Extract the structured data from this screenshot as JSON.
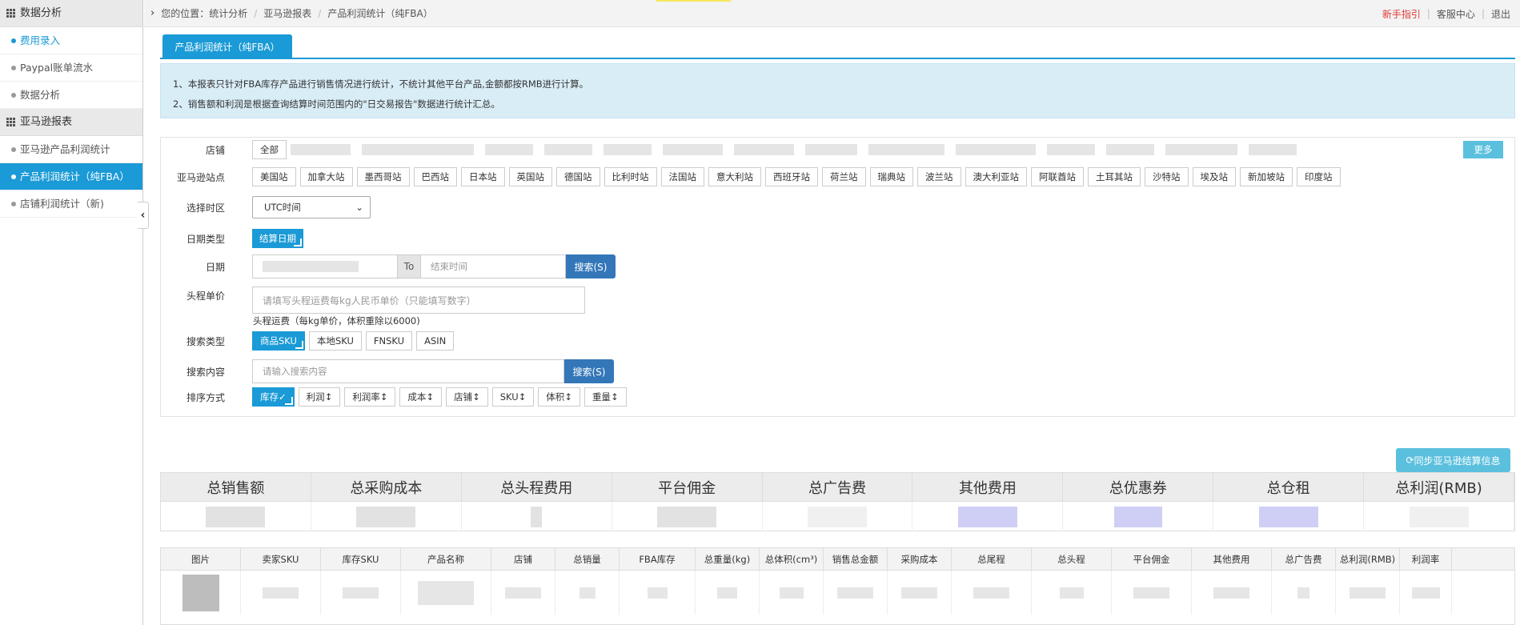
{
  "sidebar": {
    "groups": [
      {
        "title": "数据分析",
        "items": [
          "费用录入",
          "Paypal账单流水",
          "数据分析"
        ]
      },
      {
        "title": "亚马逊报表",
        "items": [
          "亚马逊产品利润统计",
          "产品利润统计（纯FBA）",
          "店铺利润统计（新)"
        ]
      }
    ],
    "active_item": "产品利润统计（纯FBA）",
    "collapse_icon": "chevron-left-icon"
  },
  "topbar": {
    "prefix": "您的位置：",
    "breadcrumb": [
      "统计分析",
      "亚马逊报表",
      "产品利润统计（纯FBA）"
    ],
    "links": [
      "新手指引",
      "客服中心",
      "退出"
    ]
  },
  "tab": {
    "label": "产品利润统计（纯FBA）"
  },
  "notice": {
    "lines": [
      "1、本报表只针对FBA库存产品进行销售情况进行统计，不统计其他平台产品,金额都按RMB进行计算。",
      "2、销售额和利润是根据查询结算时间范围内的\"日交易报告\"数据进行统计汇总。"
    ]
  },
  "form": {
    "store": {
      "label": "店铺",
      "all": "全部",
      "more": "更多"
    },
    "site": {
      "label": "亚马逊站点",
      "options": [
        "美国站",
        "加拿大站",
        "墨西哥站",
        "巴西站",
        "日本站",
        "英国站",
        "德国站",
        "比利时站",
        "法国站",
        "意大利站",
        "西班牙站",
        "荷兰站",
        "瑞典站",
        "波兰站",
        "澳大利亚站",
        "阿联酋站",
        "土耳其站",
        "沙特站",
        "埃及站",
        "新加坡站",
        "印度站"
      ]
    },
    "timezone": {
      "label": "选择时区",
      "value": "UTC时间"
    },
    "date_type": {
      "label": "日期类型",
      "value": "结算日期"
    },
    "date": {
      "label": "日期",
      "to": "To",
      "end_placeholder": "结束时间",
      "search": "搜索(S)"
    },
    "freight": {
      "label": "头程单价",
      "placeholder": "请填写头程运费每kg人民币单价（只能填写数字）",
      "hint": "头程运费（每kg单价，体积重除以6000)"
    },
    "search_type": {
      "label": "搜索类型",
      "options": [
        "商品SKU",
        "本地SKU",
        "FNSKU",
        "ASIN"
      ],
      "selected": "商品SKU"
    },
    "search_content": {
      "label": "搜索内容",
      "placeholder": "请输入搜索内容",
      "search": "搜索(S)"
    },
    "sort": {
      "label": "排序方式",
      "options": [
        "库存",
        "利润",
        "利润率",
        "成本",
        "店铺",
        "SKU",
        "体积",
        "重量"
      ],
      "selected": "库存"
    }
  },
  "sync_button": "同步亚马逊结算信息",
  "summary": {
    "headers": [
      "总销售额",
      "总采购成本",
      "总头程费用",
      "平台佣金",
      "总广告费",
      "其他费用",
      "总优惠券",
      "总仓租",
      "总利润(RMB)"
    ]
  },
  "table": {
    "headers": [
      "图片",
      "卖家SKU",
      "库存SKU",
      "产品名称",
      "店铺",
      "总销量",
      "FBA库存",
      "总重量(kg)",
      "总体积(cm³)",
      "销售总金额",
      "采购成本",
      "总尾程",
      "总头程",
      "平台佣金",
      "其他费用",
      "总广告费",
      "总利润(RMB)",
      "利润率"
    ]
  },
  "colors": {
    "accent": "#1a9ad6",
    "search_button": "#3377b9",
    "info_button": "#5bc0de",
    "notice_bg": "#d9edf7",
    "danger_link": "#e03a3a"
  }
}
